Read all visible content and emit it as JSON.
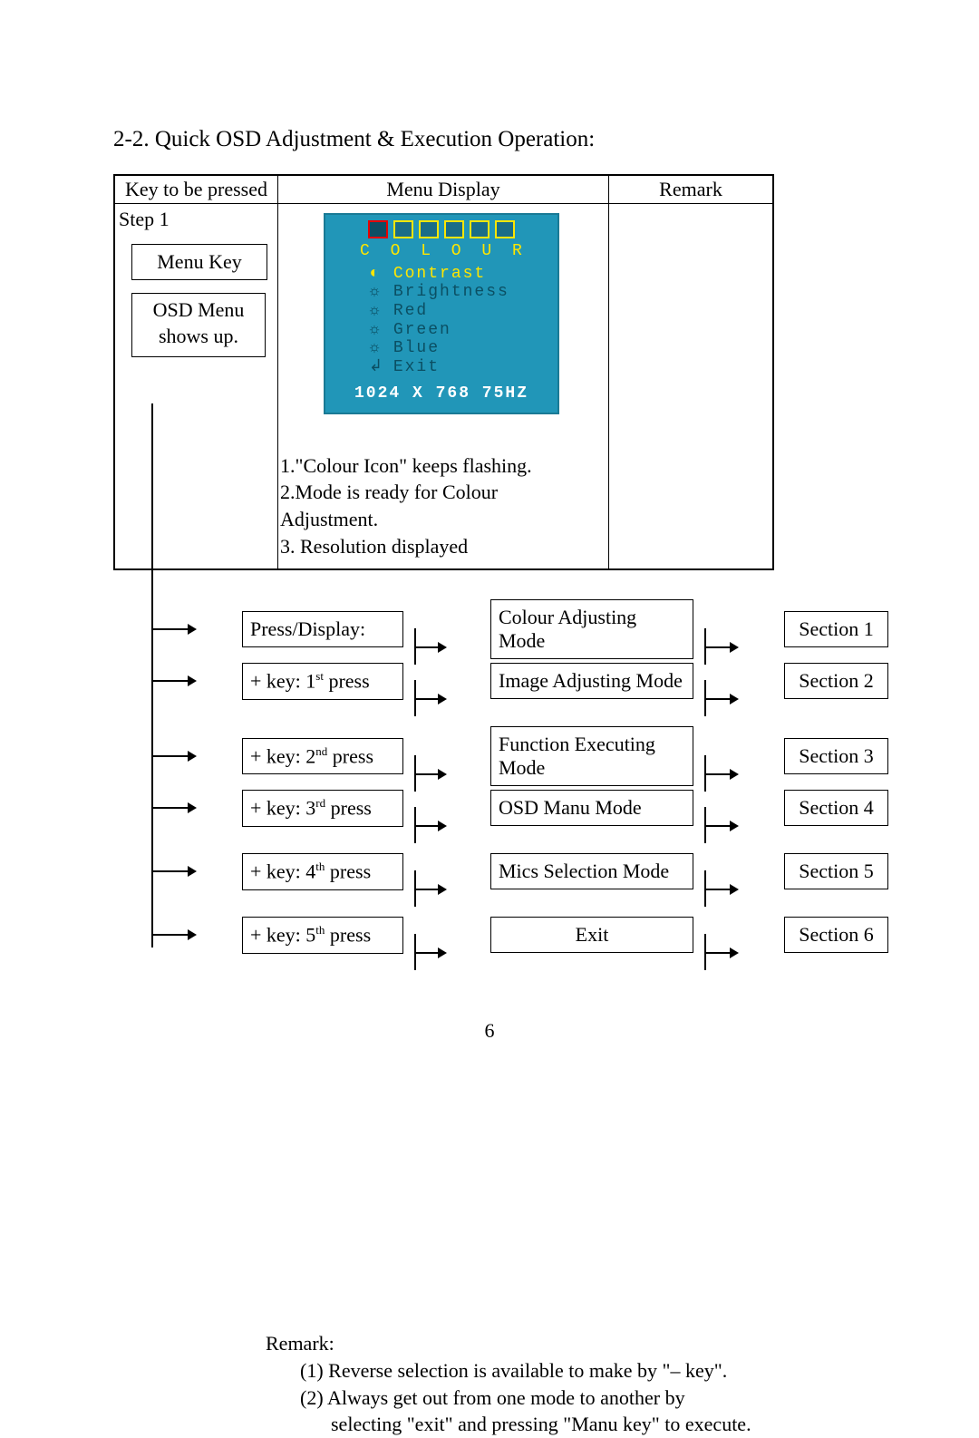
{
  "title": "2-2. Quick OSD Adjustment & Execution Operation:",
  "table": {
    "headers": {
      "c1": "Key to be pressed",
      "c2": "Menu Display",
      "c3": "Remark"
    },
    "step_label": "Step 1",
    "key_box": "Menu Key",
    "osd_show_label_a": "OSD Menu",
    "osd_show_label_b": "shows up.",
    "osd_note1": "1.\"Colour Icon\" keeps flashing.",
    "osd_note2": "2.Mode is ready for Colour Adjustment.",
    "osd_note3": "3. Resolution displayed"
  },
  "osd": {
    "title": "C O L O U R",
    "items": [
      "Contrast",
      "Brightness",
      "Red",
      "Green",
      "Blue",
      "Exit"
    ],
    "resolution": "1024 X 768 75HZ"
  },
  "flow": [
    {
      "c1_pre": "Press/Display:",
      "c1_ord": "",
      "c1_post": "",
      "c2": "Colour Adjusting Mode",
      "c3": "Section 1"
    },
    {
      "c1_pre": "+ key: 1",
      "c1_ord": "st",
      "c1_post": " press",
      "c2": "Image Adjusting Mode",
      "c3": "Section 2"
    },
    {
      "c1_pre": "+ key: 2",
      "c1_ord": "nd",
      "c1_post": " press",
      "c2": "Function Executing Mode",
      "c3": "Section 3"
    },
    {
      "c1_pre": "+ key: 3",
      "c1_ord": "rd",
      "c1_post": " press",
      "c2": "OSD Manu Mode",
      "c3": "Section 4"
    },
    {
      "c1_pre": "+ key: 4",
      "c1_ord": "th",
      "c1_post": " press",
      "c2": "Mics Selection Mode",
      "c3": "Section 5"
    },
    {
      "c1_pre": "+ key: 5",
      "c1_ord": "th",
      "c1_post": " press",
      "c2": "Exit",
      "c3": "Section 6"
    }
  ],
  "remarks": {
    "title": "Remark:",
    "r1": "(1) Reverse selection is available to make by \"– key\".",
    "r2": "(2) Always get out from one mode to another by",
    "r2b": "selecting \"exit\" and pressing \"Manu key\" to execute."
  },
  "page_number": "6",
  "chart_data": {
    "type": "table",
    "title": "Quick OSD Adjustment & Execution Operation",
    "columns": [
      "Key to be pressed",
      "Menu Display",
      "Remark"
    ],
    "rows": [
      [
        "Step 1 – Menu Key (OSD Menu shows up)",
        "COLOUR menu: Contrast / Brightness / Red / Green / Blue / Exit — 1024 X 768 75HZ; 1.\"Colour Icon\" keeps flashing. 2.Mode is ready for Colour Adjustment. 3. Resolution displayed",
        ""
      ]
    ],
    "flow_rows": [
      [
        "Press/Display:",
        "Colour Adjusting Mode",
        "Section 1"
      ],
      [
        "+ key: 1st press",
        "Image Adjusting Mode",
        "Section 2"
      ],
      [
        "+ key: 2nd press",
        "Function Executing Mode",
        "Section 3"
      ],
      [
        "+ key: 3rd press",
        "OSD Manu Mode",
        "Section 4"
      ],
      [
        "+ key: 4th press",
        "Mics Selection Mode",
        "Section 5"
      ],
      [
        "+ key: 5th press",
        "Exit",
        "Section 6"
      ]
    ]
  }
}
